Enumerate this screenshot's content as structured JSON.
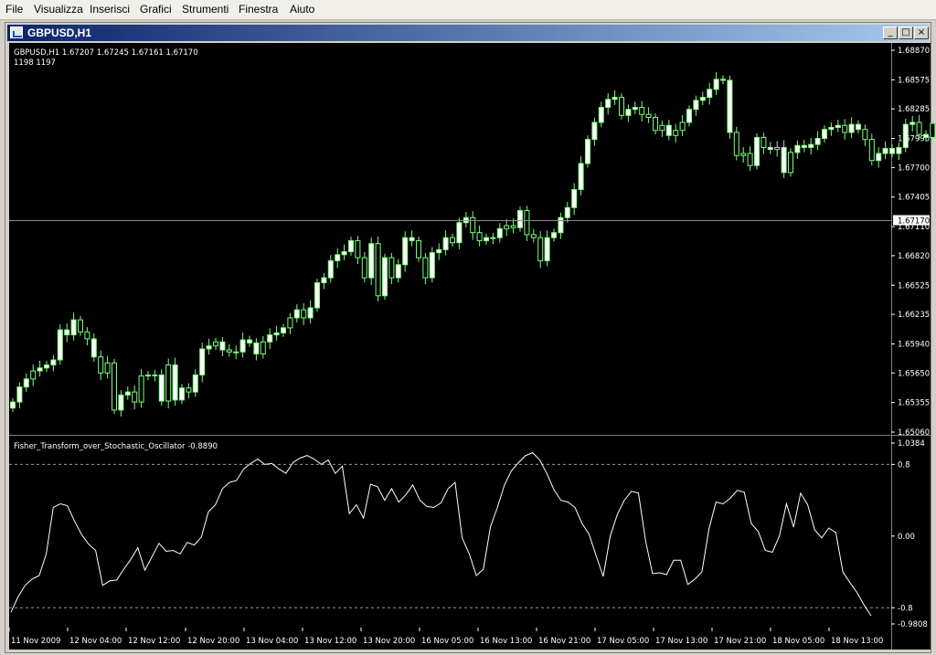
{
  "menu": [
    "File",
    "Visualizza",
    "Inserisci",
    "Grafici",
    "Strumenti",
    "Finestra",
    "Aiuto"
  ],
  "window": {
    "title": "GBPUSD,H1",
    "minimize_glyph": "_",
    "maximize_glyph": "□",
    "close_glyph": "×"
  },
  "price_chart": {
    "info_line": "GBPUSD,H1  1.67207 1.67245 1.67161 1.67170",
    "info_line2": "1198  1197",
    "current_price": "1.67170",
    "bull_color": "#ffffff",
    "wick_color": "#7cff7c",
    "background": "#000000"
  },
  "indicator": {
    "label": "Fisher_Transform_over_Stochastic_Oscillator -0.8890",
    "levels": [
      0.8,
      -0.8
    ],
    "line_color": "#ffffff"
  },
  "chart_data": [
    {
      "type": "candlestick",
      "title": "GBPUSD,H1",
      "y_ticks": [
        "1.68870",
        "1.68575",
        "1.68285",
        "1.67990",
        "1.67700",
        "1.67405",
        "1.67110",
        "1.66820",
        "1.66525",
        "1.66235",
        "1.65940",
        "1.65650",
        "1.65355",
        "1.65060"
      ],
      "ylim": [
        1.6506,
        1.6887
      ],
      "x_ticks": [
        "11 Nov 2009",
        "12 Nov 04:00",
        "12 Nov 12:00",
        "12 Nov 20:00",
        "13 Nov 04:00",
        "13 Nov 12:00",
        "13 Nov 20:00",
        "16 Nov 05:00",
        "16 Nov 13:00",
        "16 Nov 21:00",
        "17 Nov 05:00",
        "17 Nov 13:00",
        "17 Nov 21:00",
        "18 Nov 05:00",
        "18 Nov 13:00"
      ],
      "current_price": 1.6717,
      "closes": [
        1.6536,
        1.6551,
        1.6559,
        1.6567,
        1.657,
        1.6573,
        1.6578,
        1.6608,
        1.6603,
        1.6618,
        1.6606,
        1.6599,
        1.6581,
        1.6565,
        1.6575,
        1.6528,
        1.6543,
        1.6546,
        1.6536,
        1.6562,
        1.6563,
        1.6563,
        1.6537,
        1.6573,
        1.6538,
        1.655,
        1.6546,
        1.6563,
        1.6589,
        1.6592,
        1.6596,
        1.6588,
        1.6586,
        1.6586,
        1.6598,
        1.6595,
        1.6584,
        1.6596,
        1.6603,
        1.6605,
        1.661,
        1.662,
        1.6628,
        1.662,
        1.663,
        1.6655,
        1.666,
        1.6677,
        1.6683,
        1.6686,
        1.6697,
        1.668,
        1.666,
        1.6694,
        1.6642,
        1.668,
        1.666,
        1.6673,
        1.67,
        1.6697,
        1.668,
        1.666,
        1.6685,
        1.6688,
        1.67,
        1.6695,
        1.6715,
        1.672,
        1.6705,
        1.6697,
        1.67,
        1.67,
        1.6709,
        1.6712,
        1.671,
        1.6727,
        1.6703,
        1.67,
        1.6677,
        1.67,
        1.6705,
        1.672,
        1.673,
        1.6748,
        1.6774,
        1.6798,
        1.6815,
        1.683,
        1.6838,
        1.684,
        1.6822,
        1.6828,
        1.683,
        1.6823,
        1.682,
        1.6807,
        1.6812,
        1.6802,
        1.6807,
        1.6815,
        1.6828,
        1.6837,
        1.684,
        1.6848,
        1.6858,
        1.6857,
        1.6805,
        1.6782,
        1.6784,
        1.6772,
        1.68,
        1.679,
        1.6788,
        1.679,
        1.6765,
        1.6785,
        1.6792,
        1.679,
        1.6793,
        1.6799,
        1.6808,
        1.681,
        1.6812,
        1.6805,
        1.6813,
        1.6808,
        1.6798,
        1.6777,
        1.6784,
        1.6789,
        1.6784,
        1.679,
        1.6813,
        1.6815,
        1.6803,
        1.68,
        1.6814,
        1.683,
        1.68,
        1.679,
        1.6795,
        1.681,
        1.6795,
        1.6773,
        1.6762,
        1.675,
        1.673,
        1.6717
      ],
      "bullish_bar_indices": [
        0,
        1,
        2,
        4,
        5,
        6,
        7,
        8,
        9,
        12,
        16,
        17,
        22,
        24,
        25,
        27,
        28,
        29,
        31,
        33,
        34,
        35,
        36,
        38,
        39,
        40,
        42,
        44,
        45,
        46,
        47,
        48,
        49,
        50,
        53,
        55,
        57,
        58,
        59,
        62,
        63,
        64,
        66,
        67,
        70,
        71,
        72,
        75,
        79,
        80,
        81,
        82,
        83,
        84,
        85,
        86,
        87,
        88,
        89,
        91,
        92,
        97,
        100,
        101,
        102,
        103,
        104,
        105,
        106,
        110,
        112,
        114,
        116,
        117,
        118,
        119,
        120,
        121,
        122,
        124,
        125,
        128,
        129,
        130,
        131,
        132,
        133,
        135,
        138,
        139,
        140,
        143
      ]
    },
    {
      "type": "line",
      "title": "Fisher_Transform_over_Stochastic_Oscillator -0.8890",
      "y_ticks": [
        "1.0384",
        "0.8",
        "0.00",
        "-0.8",
        "-0.9808"
      ],
      "ylim": [
        -0.9808,
        1.0384
      ],
      "levels": [
        0.8,
        -0.8
      ],
      "last_value": -0.889,
      "values": [
        -0.85,
        -0.68,
        -0.55,
        -0.48,
        -0.44,
        -0.2,
        0.32,
        0.36,
        0.34,
        0.17,
        0.02,
        -0.09,
        -0.16,
        -0.55,
        -0.5,
        -0.49,
        -0.37,
        -0.26,
        -0.13,
        -0.38,
        -0.23,
        -0.08,
        -0.17,
        -0.16,
        -0.2,
        -0.07,
        -0.1,
        -0.01,
        0.27,
        0.35,
        0.53,
        0.6,
        0.62,
        0.75,
        0.81,
        0.86,
        0.8,
        0.81,
        0.75,
        0.7,
        0.82,
        0.87,
        0.9,
        0.86,
        0.8,
        0.85,
        0.7,
        0.78,
        0.25,
        0.35,
        0.2,
        0.58,
        0.55,
        0.4,
        0.53,
        0.38,
        0.46,
        0.57,
        0.4,
        0.33,
        0.32,
        0.37,
        0.53,
        0.6,
        -0.02,
        -0.2,
        -0.44,
        -0.37,
        0.1,
        0.32,
        0.57,
        0.73,
        0.82,
        0.9,
        0.93,
        0.85,
        0.7,
        0.52,
        0.4,
        0.38,
        0.32,
        0.14,
        0.02,
        -0.22,
        -0.45,
        0.0,
        0.24,
        0.4,
        0.5,
        0.48,
        -0.05,
        -0.42,
        -0.41,
        -0.43,
        -0.27,
        -0.27,
        -0.54,
        -0.48,
        -0.4,
        0.08,
        0.38,
        0.36,
        0.42,
        0.51,
        0.49,
        0.14,
        0.05,
        -0.16,
        -0.18,
        0.0,
        0.36,
        0.1,
        0.48,
        0.35,
        0.07,
        -0.02,
        0.09,
        0.04,
        -0.4,
        -0.52,
        -0.63,
        -0.77,
        -0.89
      ]
    }
  ]
}
